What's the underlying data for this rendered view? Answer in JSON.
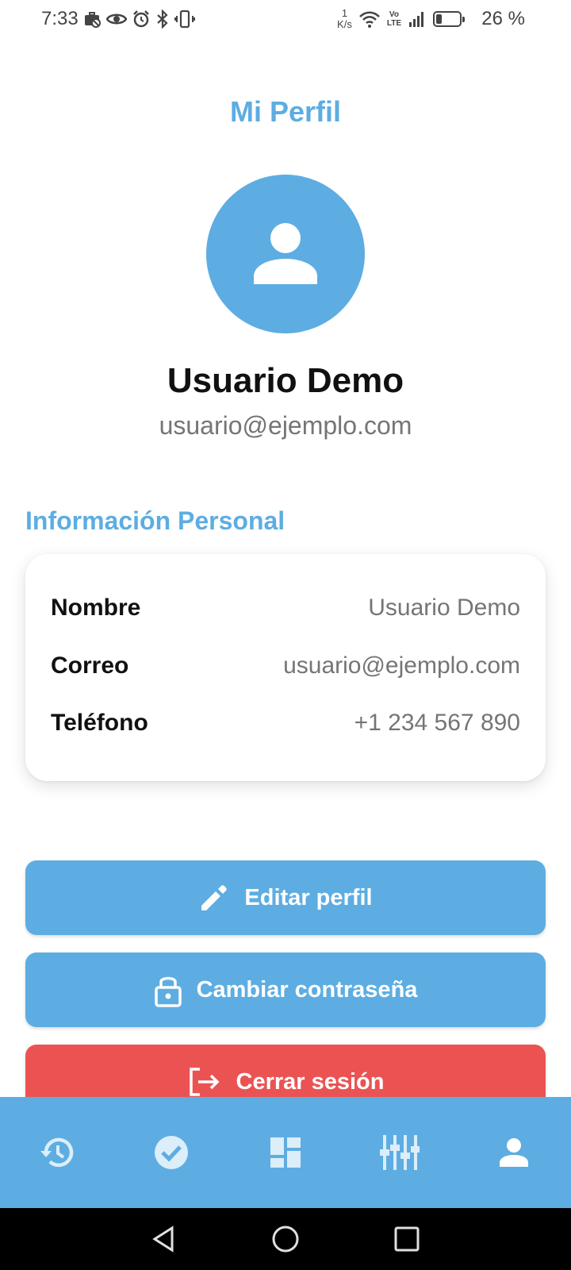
{
  "status_bar": {
    "time": "7:33",
    "net_speed_value": "1",
    "net_speed_unit": "K/s",
    "volte_top": "Vo",
    "volte_bottom": "LTE",
    "battery_percent": "26 %",
    "battery_level": 0.26,
    "left_icons": [
      "briefcase-off-icon",
      "eye-icon",
      "alarm-icon",
      "bluetooth-icon",
      "vibrate-icon"
    ],
    "right_icons": [
      "wifi-icon",
      "signal-icon",
      "battery-icon"
    ]
  },
  "header": {
    "title": "Mi Perfil"
  },
  "profile": {
    "name": "Usuario Demo",
    "email": "usuario@ejemplo.com",
    "avatar_icon": "person-icon"
  },
  "personal_info": {
    "section_title": "Información Personal",
    "rows": [
      {
        "label": "Nombre",
        "value": "Usuario Demo"
      },
      {
        "label": "Correo",
        "value": "usuario@ejemplo.com"
      },
      {
        "label": "Teléfono",
        "value": "+1 234 567 890"
      }
    ]
  },
  "actions": {
    "edit_label": "Editar perfil",
    "edit_icon": "pencil-icon",
    "change_password_label": "Cambiar contraseña",
    "change_password_icon": "lock-icon",
    "logout_label": "Cerrar sesión",
    "logout_icon": "logout-icon"
  },
  "bottom_nav": {
    "items": [
      "history-icon",
      "check-circle-icon",
      "dashboard-icon",
      "equalizer-icon",
      "person-icon"
    ],
    "active": "person-icon"
  },
  "system_nav": {
    "items": [
      "back-icon",
      "home-icon",
      "recents-icon"
    ]
  },
  "colors": {
    "primary": "#5dade2",
    "danger": "#eb5353",
    "text_dark": "#111111",
    "text_muted": "#757575"
  }
}
